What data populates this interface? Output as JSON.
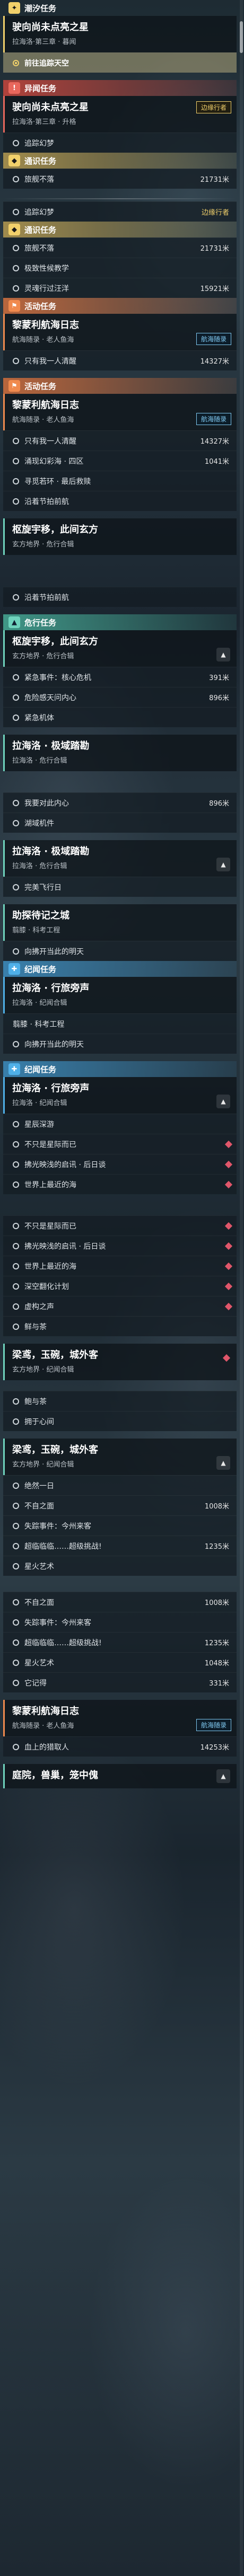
{
  "colors": {
    "gold": "#f1d06b",
    "red": "#e8675c",
    "teal": "#6fd3bd",
    "orange": "#f08a4e",
    "blue": "#4fb0e8"
  },
  "categories": {
    "lunar": "潮汐任务",
    "unique": "异闻任务",
    "normal": "通识任务",
    "activity": "活动任务",
    "danger": "危行任务",
    "chronicle": "纪闻任务"
  },
  "quests": {
    "star": {
      "title": "驶向尚未点亮之星",
      "sub": "拉海洛·第三章 · 暮闻"
    },
    "star2": {
      "title": "驶向尚未点亮之星",
      "sub": "拉海洛·第三章 · 升格"
    },
    "log": {
      "title": "黎蒙利航海日志",
      "sub": "航海随录 · 老人鱼海"
    },
    "xuan": {
      "title": "枢旋宇移，此间玄方",
      "sub": "玄方地界 · 危行合辑"
    },
    "ji": {
      "title": "拉海洛 · 极域踏勘",
      "sub": "拉海洛 · 危行合辑"
    },
    "jiban": {
      "title": "助探待记之城",
      "sub": "翦膝 · 科考工程"
    },
    "xing": {
      "title": "拉海洛 · 行旅旁声",
      "sub": "拉海洛 · 纪闻合辑"
    },
    "liang": {
      "title": "梁鸢，玉碗，城外客",
      "sub": "玄方地界 · 纪闻合辑"
    },
    "end": {
      "title": "庭院，兽巢，笼中傀",
      "sub": ""
    }
  },
  "tags": {
    "wanderer": "边缘行者",
    "voyage": "航海随录"
  },
  "steps": {
    "track": "前往追踪天空",
    "t1": "追踪幻梦",
    "t2": "旅舰不落",
    "t3": "极致性候教学",
    "t4": "灵魂行过汪洋",
    "l1": "只有我一人清醒",
    "l2": "涌现幻彩海 · 四区",
    "l3": "寻觅若环 · 最后救赎",
    "l4": "沿着节拍前航",
    "x1": "紧急事件：核心危机",
    "x2": "危险感天问内心",
    "x3": "紧急机体",
    "j1": "我要对此内心",
    "j2": "湖域机件",
    "jb1": "完美飞行日",
    "jb2": "向拂开当此的明天",
    "xg1": "星辰深游",
    "xg2": "不只是星际而已",
    "xg3": "拂光映浅的启讯 · 后日谈",
    "xg4": "世界上最近的海",
    "xg5": "深空翻化计划",
    "xg6": "虚构之声",
    "xg7": "鲜与茶",
    "lg1": "鲍与茶",
    "lg2": "拥于心间",
    "lg3": "绝然一日",
    "lg4": "不自之面",
    "lg5": "失踪事件：今州来客",
    "lg6": "超临临临……超级挑战!",
    "lg7": "星火艺术",
    "lg8": "它记得",
    "e1": "血上的猎取人"
  },
  "distances": {
    "t2": "21731米",
    "t4": "15921米",
    "l1": "14327米",
    "l2": "1041米",
    "x1": "391米",
    "x2": "896米",
    "lg4": "1008米",
    "lg6": "1235米",
    "lg7": "1048米",
    "lg8": "331米",
    "log2": "14253米"
  }
}
